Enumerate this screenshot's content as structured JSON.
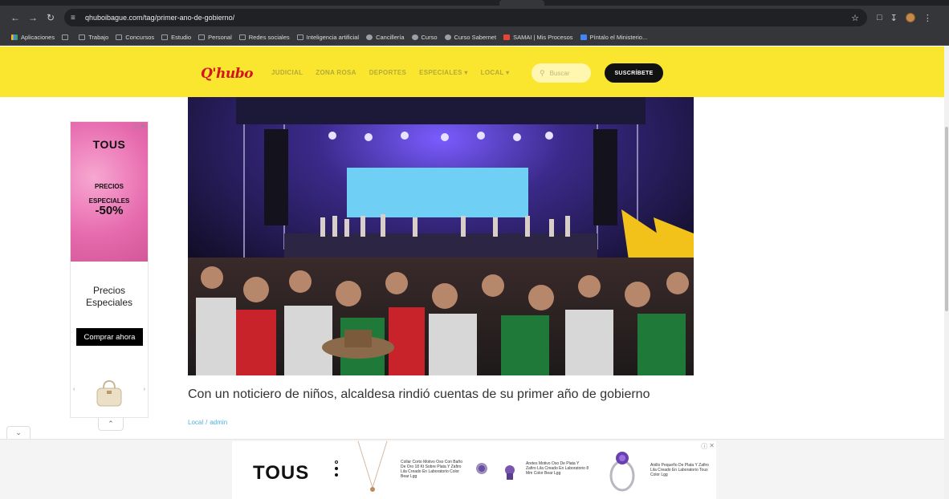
{
  "browser": {
    "url": "qhuboibague.com/tag/primer-ano-de-gobierno/",
    "bookmarks": [
      "Aplicaciones",
      "Trabajo",
      "Concursos",
      "Estudio",
      "Personal",
      "Redes sociales",
      "Inteligencia artificial",
      "Cancillería",
      "Curso",
      "Curso Sabernet",
      "SAMAI | Mis Procesos",
      "Píntalo el Ministerio..."
    ]
  },
  "site": {
    "logo": "Q'hubo",
    "nav": [
      "JUDICIAL",
      "ZONA ROSA",
      "DEPORTES",
      "ESPECIALES ▾",
      "LOCAL ▾"
    ],
    "search_placeholder": "Buscar",
    "subscribe_label": "SUSCRÍBETE"
  },
  "article": {
    "headline": "Con un noticiero de niños, alcaldesa rindió cuentas de su primer año de gobierno",
    "category": "Local",
    "separator": "/",
    "author": "admin"
  },
  "ad_left": {
    "brand": "TOUS",
    "promo_line1": "PRECIOS",
    "promo_line2": "ESPECIALES",
    "promo_discount": "-50%",
    "tagline_line1": "Precios",
    "tagline_line2": "Especiales",
    "cta_label": "Comprar ahora"
  },
  "ad_bottom": {
    "brand": "TOUS",
    "products": [
      "Collar Corto Motivo Oso Con Baño De Oro 18 Kt Sobre Plata Y Zafiro Lila Creado En Laboratorio Color Bear Lgg",
      "Aretes Motivo Oso De Plata Y Zafiro Lila Creado En Laboratorio 8 Mm Color Bear Lgg",
      "Anillo Pequeño De Plata Y Zafiro Lila Creado En Laboratorio Tous Color Lgg"
    ]
  },
  "colors": {
    "header_yellow": "#fbe62f",
    "logo_red": "#d4141f",
    "meta_blue": "#4fb0e0",
    "ad_pink": "#e97fbb"
  }
}
